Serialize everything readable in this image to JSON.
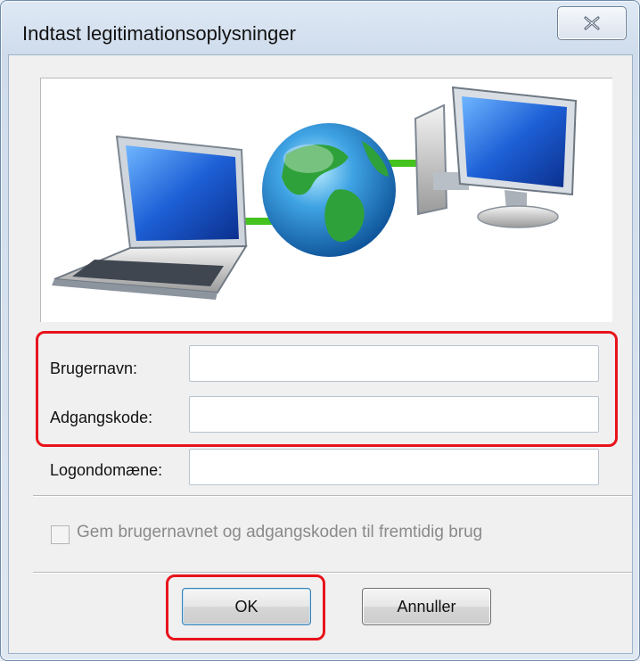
{
  "dialog": {
    "title": "Indtast legitimationsoplysninger",
    "close_glyph": "close-icon"
  },
  "banner": {
    "description_icons": [
      "laptop-icon",
      "globe-icon",
      "desktop-computer-icon"
    ]
  },
  "form": {
    "username_label": "Brugernavn:",
    "username_value": "",
    "password_label": "Adgangskode:",
    "password_value": "",
    "domain_label": "Logondomæne:",
    "domain_value": ""
  },
  "remember": {
    "label": "Gem brugernavnet og adgangskoden til fremtidig brug",
    "checked": false,
    "enabled": false
  },
  "buttons": {
    "ok_label": "OK",
    "cancel_label": "Annuller"
  },
  "colors": {
    "highlight": "#e8131b",
    "link_green": "#44c21d"
  }
}
